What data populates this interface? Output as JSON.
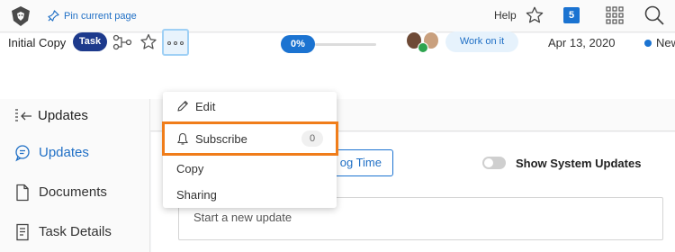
{
  "topbar": {
    "pin_label": "Pin current page",
    "help_label": "Help",
    "notification_count": "5"
  },
  "task": {
    "name": "Initial Copy",
    "type_badge": "Task",
    "progress": "0%",
    "progress_fraction": 0,
    "status": "Work on it",
    "due_date": "Apr 13, 2020",
    "condition": "New"
  },
  "nav": {
    "header": "Updates",
    "items": [
      {
        "label": "Updates",
        "icon": "chat-bubble-icon",
        "active": true
      },
      {
        "label": "Documents",
        "icon": "document-icon",
        "active": false
      },
      {
        "label": "Task Details",
        "icon": "details-icon",
        "active": false
      }
    ]
  },
  "main": {
    "log_time_label": "og Time",
    "system_updates_label": "Show System Updates",
    "update_placeholder": "Start a new update"
  },
  "menu": {
    "edit": "Edit",
    "subscribe": "Subscribe",
    "subscribe_count": "0",
    "copy": "Copy",
    "sharing": "Sharing"
  },
  "colors": {
    "accent": "#1b73d1",
    "task_badge": "#1d3a8c",
    "highlight": "#f07d1a",
    "status_bg": "#e6f2fc"
  }
}
